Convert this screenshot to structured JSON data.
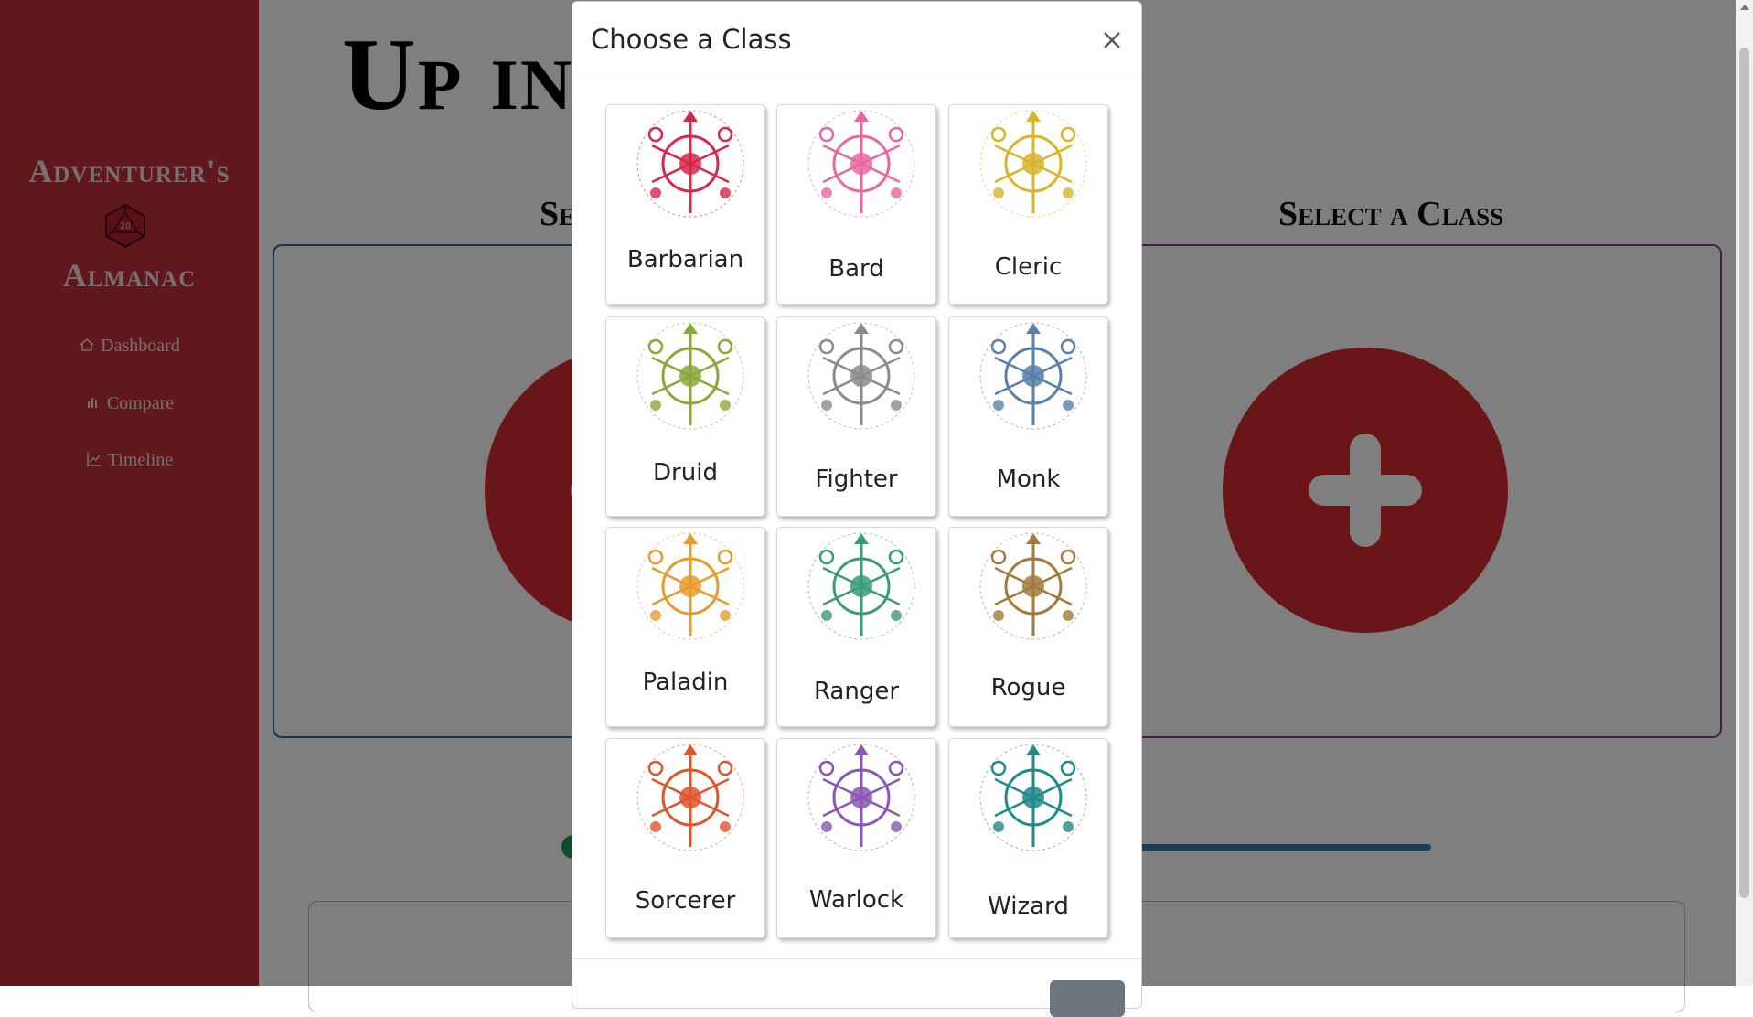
{
  "sidebar": {
    "brand_top": "Adventurer's",
    "brand_bottom": "Almanac",
    "d20_label": "20",
    "nav": [
      {
        "label": "Dashboard",
        "icon": "home-icon"
      },
      {
        "label": "Compare",
        "icon": "bar-chart-icon"
      },
      {
        "label": "Timeline",
        "icon": "line-chart-icon"
      }
    ]
  },
  "main": {
    "title": "Up in",
    "select_left": "Se",
    "select_right": "Select a Class"
  },
  "modal": {
    "title": "Choose a Class",
    "close_icon": "close-icon",
    "classes": [
      {
        "name": "Barbarian",
        "color": "#d7274b",
        "icon": "barbarian-emblem-icon"
      },
      {
        "name": "Bard",
        "color": "#e867a0",
        "icon": "bard-emblem-icon"
      },
      {
        "name": "Cleric",
        "color": "#d8b52a",
        "icon": "cleric-emblem-icon"
      },
      {
        "name": "Druid",
        "color": "#8aa83a",
        "icon": "druid-emblem-icon"
      },
      {
        "name": "Fighter",
        "color": "#8b8b8b",
        "icon": "fighter-emblem-icon"
      },
      {
        "name": "Monk",
        "color": "#5a7fa8",
        "icon": "monk-emblem-icon"
      },
      {
        "name": "Paladin",
        "color": "#e79a2d",
        "icon": "paladin-emblem-icon"
      },
      {
        "name": "Ranger",
        "color": "#3c9a7a",
        "icon": "ranger-emblem-icon"
      },
      {
        "name": "Rogue",
        "color": "#a37a3b",
        "icon": "rogue-emblem-icon"
      },
      {
        "name": "Sorcerer",
        "color": "#e0542b",
        "icon": "sorcerer-emblem-icon"
      },
      {
        "name": "Warlock",
        "color": "#8a57b3",
        "icon": "warlock-emblem-icon"
      },
      {
        "name": "Wizard",
        "color": "#1f8a8a",
        "icon": "wizard-emblem-icon"
      }
    ]
  }
}
